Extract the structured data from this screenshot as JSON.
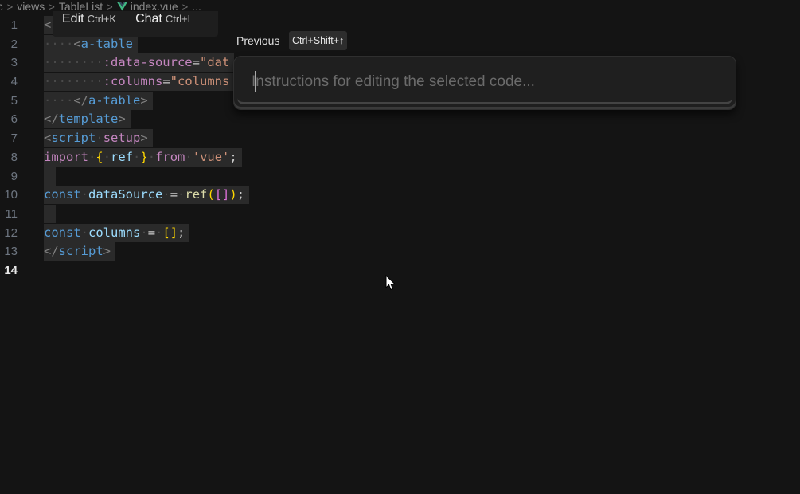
{
  "breadcrumb": {
    "items": [
      "rc",
      "views",
      "TableList",
      "index.vue",
      "..."
    ]
  },
  "edit_chat": {
    "edit_label": "Edit",
    "edit_shortcut": "Ctrl+K",
    "chat_label": "Chat",
    "chat_shortcut": "Ctrl+L"
  },
  "prompt": {
    "previous_label": "Previous",
    "previous_shortcut": "Ctrl+Shift+↑",
    "placeholder": "Instructions for editing the selected code..."
  },
  "editor": {
    "current_line": 14,
    "line_numbers": [
      "1",
      "2",
      "3",
      "4",
      "5",
      "6",
      "7",
      "8",
      "9",
      "10",
      "11",
      "12",
      "13",
      "14"
    ],
    "code": {
      "l2_tag": "a-table",
      "l3_attr": ":data-source",
      "l3_val": "\"dat",
      "l4_attr": ":columns",
      "l4_val": "\"columns",
      "l5_tag": "a-table",
      "l6_tag": "template",
      "l7_tag": "script",
      "l7_attr": "setup",
      "l8_import": "import",
      "l8_ref": "ref",
      "l8_from": "from",
      "l8_module": "'vue'",
      "l10_const": "const",
      "l10_name": "dataSource",
      "l10_fn": "ref",
      "l12_const": "const",
      "l12_name": "columns",
      "l13_tag": "script"
    }
  }
}
